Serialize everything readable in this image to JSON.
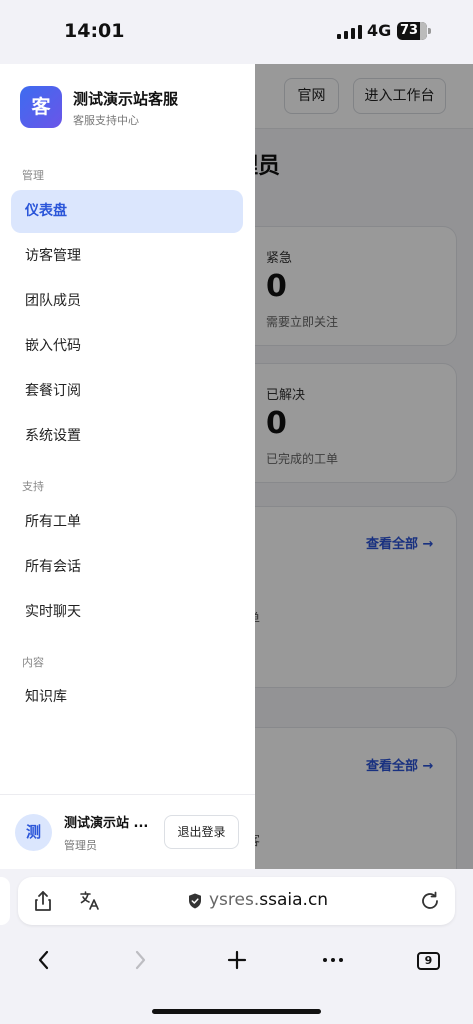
{
  "status": {
    "time": "14:01",
    "network": "4G",
    "battery": "73"
  },
  "background": {
    "buttons": {
      "official": "官网",
      "workspace": "进入工作台"
    },
    "heading_fragment": "理员",
    "cards": [
      {
        "label": "紧急",
        "value": "0",
        "sub": "需要立即关注"
      },
      {
        "label": "已解决",
        "value": "0",
        "sub": "已完成的工单"
      }
    ],
    "view_all": "查看全部 →",
    "fragment_1": "单",
    "fragment_2": "客"
  },
  "drawer": {
    "logo_char": "客",
    "app_name": "测试演示站客服",
    "app_sub": "客服支持中心",
    "sections": {
      "manage": "管理",
      "support": "支持",
      "content": "内容"
    },
    "manage_items": [
      "仪表盘",
      "访客管理",
      "团队成员",
      "嵌入代码",
      "套餐订阅",
      "系统设置"
    ],
    "support_items": [
      "所有工单",
      "所有会话",
      "实时聊天"
    ],
    "content_items": [
      "知识库"
    ],
    "user": {
      "avatar_char": "测",
      "name": "测试演示站 ...",
      "role": "管理员",
      "logout": "退出登录"
    }
  },
  "browser": {
    "url_secure": "ysres.",
    "url_domain": "ssaia.cn",
    "tab_count": "9"
  }
}
